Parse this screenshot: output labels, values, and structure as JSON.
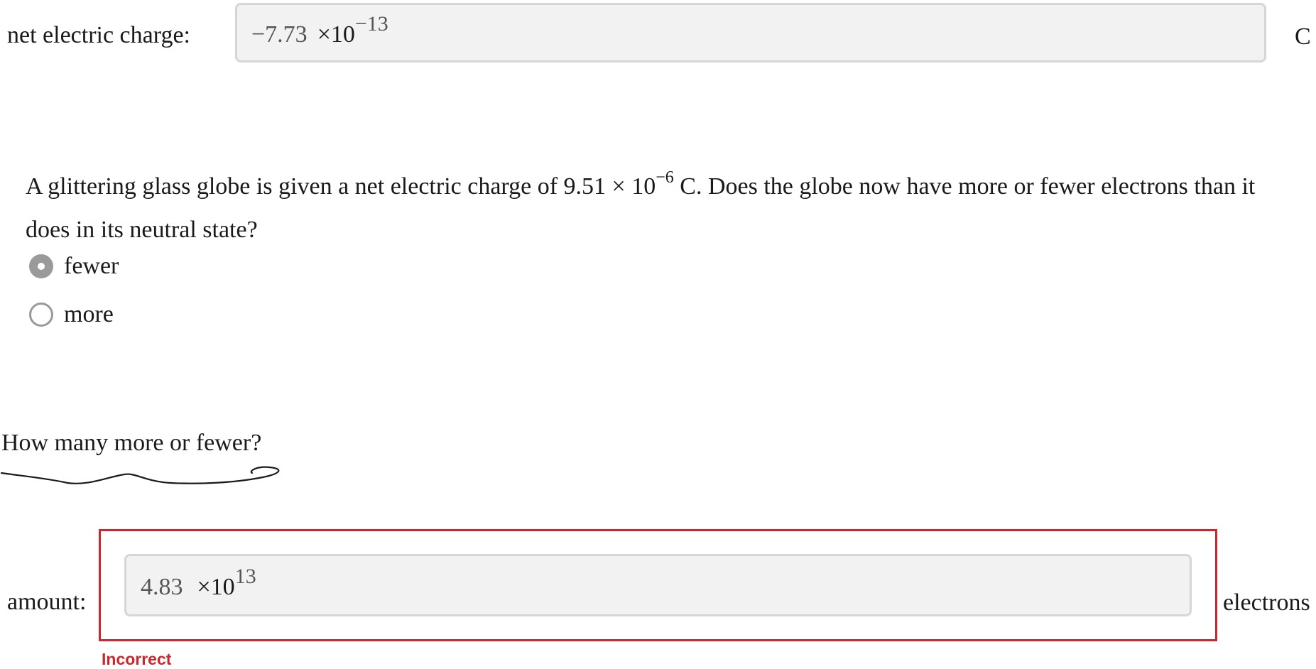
{
  "charge_row": {
    "label": "net electric charge:",
    "value": "−7.73",
    "multiplier": "×10",
    "exponent": "−13",
    "unit": "C"
  },
  "question": {
    "text_before": "A glittering glass globe is given a net electric charge of 9.51 × 10",
    "exponent": "−6",
    "text_after": " C. Does the globe now have more or fewer electrons than it does in its neutral state?",
    "options": [
      {
        "label": "fewer",
        "selected": true
      },
      {
        "label": "more",
        "selected": false
      }
    ]
  },
  "followup": {
    "prompt": "How many more or fewer?"
  },
  "amount_row": {
    "label": "amount:",
    "value": "4.83",
    "multiplier": "×10",
    "exponent": "13",
    "unit": "electrons",
    "feedback": "Incorrect"
  },
  "colors": {
    "error": "#c8282e",
    "input_background": "#f2f2f2",
    "radio_selected": "#9a9a9a"
  }
}
